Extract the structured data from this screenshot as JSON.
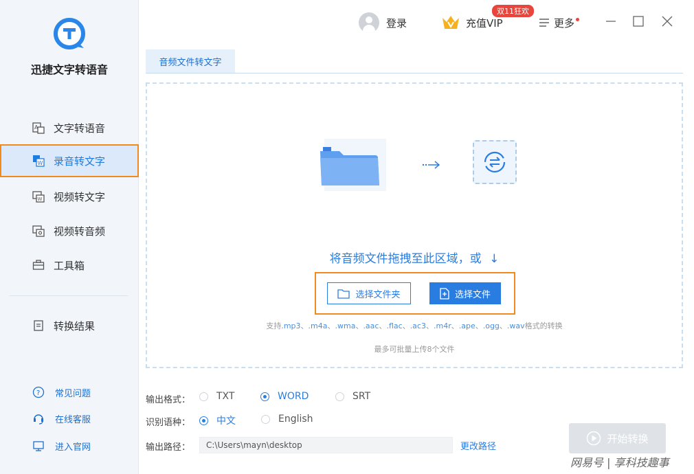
{
  "app": {
    "name": "迅捷文字转语音"
  },
  "sidebar": {
    "items": [
      {
        "label": "文字转语音",
        "icon": "text-to-speech-icon"
      },
      {
        "label": "录音转文字",
        "icon": "recording-to-text-icon",
        "active": true
      },
      {
        "label": "视频转文字",
        "icon": "video-to-text-icon"
      },
      {
        "label": "视频转音频",
        "icon": "video-to-audio-icon"
      },
      {
        "label": "工具箱",
        "icon": "toolbox-icon"
      },
      {
        "label": "转换结果",
        "icon": "results-icon"
      }
    ],
    "links": [
      {
        "label": "常见问题",
        "icon": "question-icon"
      },
      {
        "label": "在线客服",
        "icon": "headset-icon"
      },
      {
        "label": "进入官网",
        "icon": "monitor-icon"
      }
    ]
  },
  "topbar": {
    "login_label": "登录",
    "vip_label": "充值VIP",
    "promo_badge": "双11狂欢",
    "more_label": "更多"
  },
  "tab": {
    "label": "音频文件转文字"
  },
  "dropzone": {
    "hint": "将音频文件拖拽至此区域，或",
    "select_folder_label": "选择文件夹",
    "select_file_label": "选择文件",
    "support_prefix": "支持",
    "formats": [
      ".mp3",
      ".m4a",
      ".wma",
      ".aac",
      ".flac",
      ".ac3",
      ".m4r",
      ".ape",
      ".ogg",
      ".wav"
    ],
    "format_separator": "、",
    "support_suffix": "格式的转换",
    "limit_text": "最多可批量上传8个文件"
  },
  "options": {
    "output_format_label": "输出格式：",
    "output_formats": [
      {
        "label": "TXT",
        "checked": false
      },
      {
        "label": "WORD",
        "checked": true
      },
      {
        "label": "SRT",
        "checked": false
      }
    ],
    "language_label": "识别语种：",
    "languages": [
      {
        "label": "中文",
        "checked": true
      },
      {
        "label": "English",
        "checked": false
      }
    ],
    "output_path_label": "输出路径：",
    "output_path_value": "C:\\Users\\mayn\\desktop",
    "change_path_label": "更改路径"
  },
  "start_button": {
    "label": "开始转换"
  },
  "watermark": "网易号 | 享科技趣事",
  "colors": {
    "accent": "#2a7de0",
    "highlight": "#f08a1c",
    "promo": "#e8453c",
    "sidebar_bg": "#f2f6fb"
  }
}
